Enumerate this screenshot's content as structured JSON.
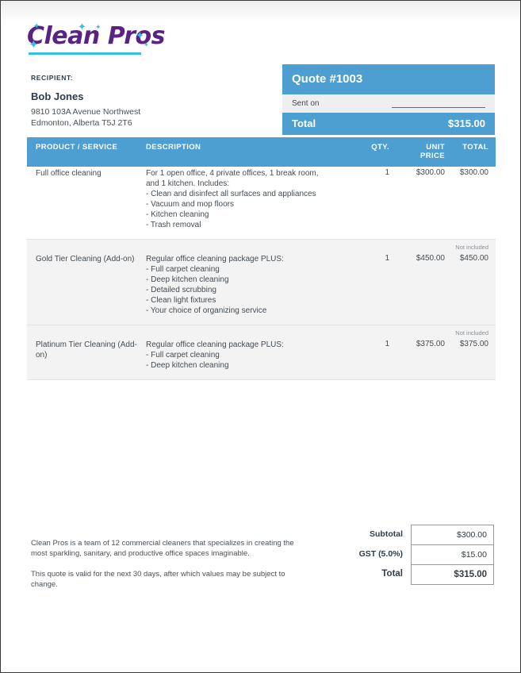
{
  "brand": {
    "logo_text": "Clean Pros",
    "logo_color": "#5a2382",
    "accent_color": "#36c0dd",
    "table_accent": "#4e9fd1",
    "sparkle_glyph": "✦"
  },
  "recipient": {
    "label": "RECIPIENT:",
    "name": "Bob Jones",
    "address_line1": "9810 103A Avenue Northwest",
    "address_line2": "Edmonton, Alberta T5J 2T6"
  },
  "quote_box": {
    "title": "Quote #1003",
    "sent_on_label": "Sent on",
    "sent_on_value": "",
    "total_label": "Total",
    "total_value": "$315.00"
  },
  "table": {
    "headers": {
      "product": "PRODUCT / SERVICE",
      "description": "DESCRIPTION",
      "qty": "QTY.",
      "unit_price_line1": "UNIT",
      "unit_price_line2": "PRICE",
      "total": "TOTAL"
    },
    "rows": [
      {
        "badge": "",
        "product": "Full office cleaning",
        "description_lines": [
          "For 1 open office, 4 private offices, 1 break room,",
          "and 1 kitchen. Includes:",
          "- Clean and disinfect all surfaces and appliances",
          "- Vacuum and mop floors",
          "- Kitchen cleaning",
          "- Trash removal"
        ],
        "qty": "1",
        "unit_price": "$300.00",
        "total": "$300.00",
        "shaded": false
      },
      {
        "badge": "Not included",
        "product": "Gold Tier Cleaning (Add-on)",
        "description_lines": [
          "Regular office cleaning package PLUS:",
          "- Full carpet cleaning",
          "- Deep kitchen cleaning",
          "- Detailed scrubbing",
          "- Clean light fixtures",
          "- Your choice of organizing service"
        ],
        "qty": "1",
        "unit_price": "$450.00",
        "total": "$450.00",
        "shaded": true
      },
      {
        "badge": "Not included",
        "product": "Platinum Tier Cleaning (Add-on)",
        "description_lines": [
          "Regular office cleaning package PLUS:",
          "- Full carpet cleaning",
          "- Deep kitchen cleaning"
        ],
        "qty": "1",
        "unit_price": "$375.00",
        "total": "$375.00",
        "shaded": true
      }
    ]
  },
  "footer": {
    "note1": "Clean Pros is a team of 12 commercial cleaners that specializes in creating the most sparkling, sanitary, and productive office spaces imaginable.",
    "note2": "This quote is valid for the next 30 days, after which values may be subject to change."
  },
  "totals": {
    "subtotal_label": "Subtotal",
    "subtotal_value": "$300.00",
    "tax_label": "GST (5.0%)",
    "tax_value": "$15.00",
    "total_label": "Total",
    "total_value": "$315.00"
  }
}
